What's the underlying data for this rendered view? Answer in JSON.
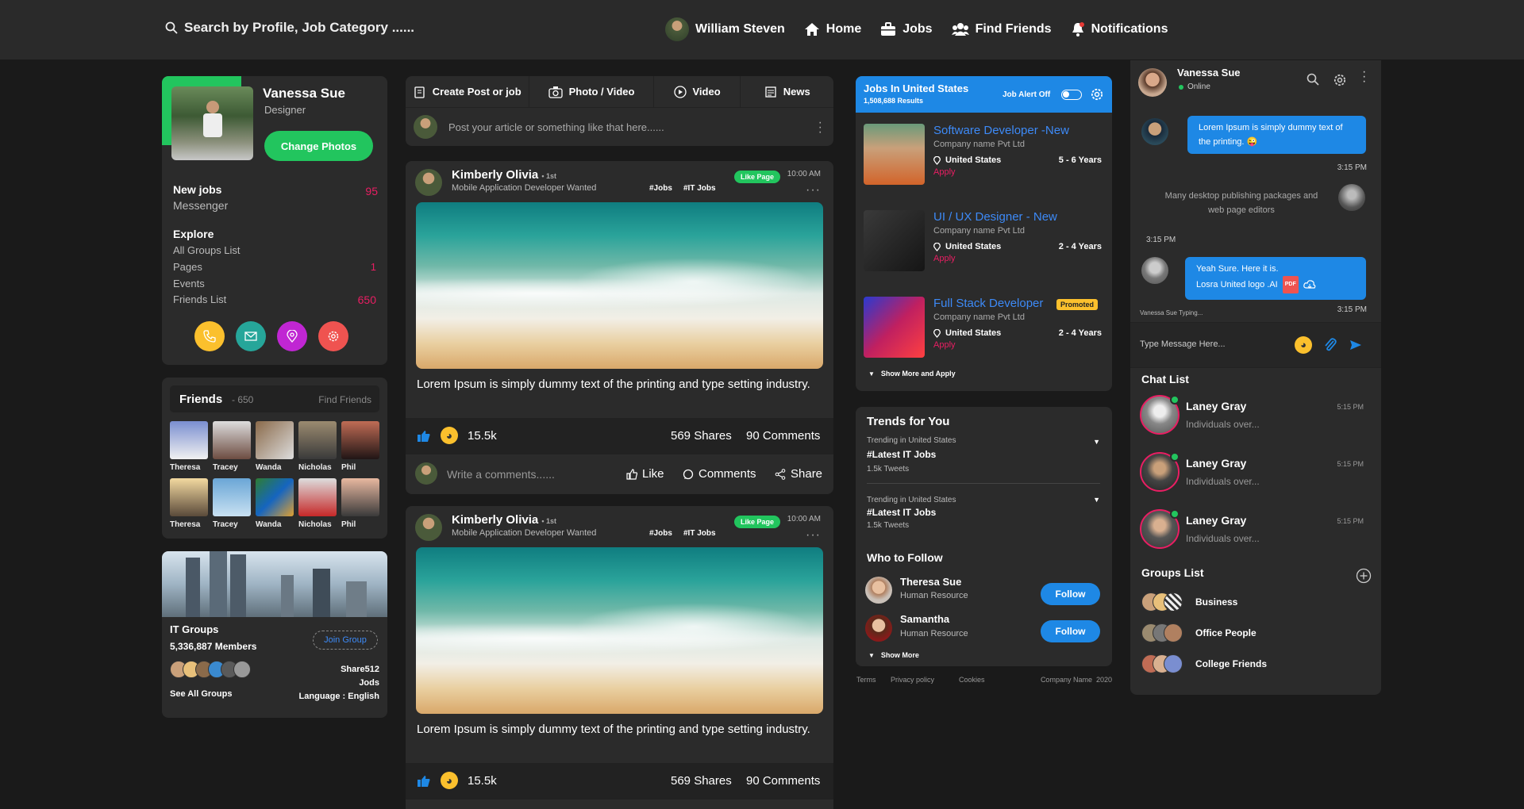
{
  "topbar": {
    "search_placeholder": "Search by Profile, Job Category ......",
    "user_name": "William Steven",
    "nav": [
      "Home",
      "Jobs",
      "Find Friends",
      "Notifications"
    ]
  },
  "profile": {
    "name": "Vanessa Sue",
    "role": "Designer",
    "change_photos": "Change Photos",
    "new_jobs_label": "New jobs",
    "new_jobs_count": "95",
    "messenger": "Messenger",
    "explore": "Explore",
    "links": [
      {
        "label": "All Groups List",
        "count": ""
      },
      {
        "label": "Pages",
        "count": "1"
      },
      {
        "label": "Events",
        "count": ""
      },
      {
        "label": "Friends List",
        "count": "650"
      }
    ]
  },
  "friends": {
    "title": "Friends",
    "count": "- 650",
    "find": "Find Friends",
    "row1": [
      "Theresa",
      "Tracey",
      "Wanda",
      "Nicholas",
      "Phil"
    ],
    "row2": [
      "Theresa",
      "Tracey",
      "Wanda",
      "Nicholas",
      "Phil"
    ]
  },
  "groups_card": {
    "title": "IT Groups",
    "members": "5,336,887 Members",
    "join": "Join Group",
    "share": "Share512",
    "jods": "Jods",
    "language": "Language : English",
    "see_all": "See All Groups"
  },
  "composer": {
    "tabs": [
      "Create Post or job",
      "Photo / Video",
      "Video",
      "News"
    ],
    "placeholder": "Post your article or something like that here......"
  },
  "posts": [
    {
      "author": "Kimberly Olivia",
      "degree": "• 1st",
      "subtitle": "Mobile Application Developer Wanted",
      "tags": [
        "#Jobs",
        "#IT Jobs"
      ],
      "badge": "Like Page",
      "time": "10:00 AM",
      "text": "Lorem Ipsum is simply dummy text of the printing and type setting industry.",
      "likes": "15.5k",
      "shares": "569 Shares",
      "comments": "90 Comments",
      "comment_placeholder": "Write a comments......",
      "actions": [
        "Like",
        "Comments",
        "Share"
      ]
    },
    {
      "author": "Kimberly Olivia",
      "degree": "• 1st",
      "subtitle": "Mobile Application Developer Wanted",
      "tags": [
        "#Jobs",
        "#IT Jobs"
      ],
      "badge": "Like Page",
      "time": "10:00 AM",
      "text": "Lorem Ipsum is simply dummy text of the printing and type setting industry.",
      "likes": "15.5k",
      "shares": "569 Shares",
      "comments": "90 Comments"
    }
  ],
  "jobs": {
    "title": "Jobs In United States",
    "results": "1,508,688 Results",
    "alert": "Job Alert Off",
    "items": [
      {
        "title": "Software Developer -New",
        "company": "Company name Pvt Ltd",
        "location": "United States",
        "exp": "5 - 6 Years",
        "apply": "Apply",
        "promoted": ""
      },
      {
        "title": "UI / UX Designer - New",
        "company": "Company name Pvt Ltd",
        "location": "United States",
        "exp": "2 - 4 Years",
        "apply": "Apply",
        "promoted": ""
      },
      {
        "title": "Full Stack Developer",
        "company": "Company name Pvt Ltd",
        "location": "United States",
        "exp": "2 - 4 Years",
        "apply": "Apply",
        "promoted": "Promoted"
      }
    ],
    "more": "Show More and Apply"
  },
  "trends": {
    "title": "Trends for You",
    "items": [
      {
        "label": "Trending in United States",
        "tag": "#Latest IT Jobs",
        "count": "1.5k Tweets"
      },
      {
        "label": "Trending in United States",
        "tag": "#Latest IT Jobs",
        "count": "1.5k Tweets"
      }
    ],
    "follow_title": "Who to Follow",
    "follow": [
      {
        "name": "Theresa Sue",
        "role": "Human Resource",
        "btn": "Follow"
      },
      {
        "name": "Samantha",
        "role": "Human Resource",
        "btn": "Follow"
      }
    ],
    "show_more": "Show More"
  },
  "footer": {
    "links": [
      "Terms",
      "Privacy policy",
      "Cookies"
    ],
    "company": "Company Name  2020"
  },
  "chat": {
    "name": "Vanessa Sue",
    "status": "Online",
    "messages": [
      {
        "text": "Lorem Ipsum is simply dummy text of the printing. 😜",
        "time": "3:15 PM"
      },
      {
        "text": "Many desktop publishing packages and web page editors",
        "time": "3:15 PM"
      },
      {
        "text1": "Yeah Sure. Here it is.",
        "text2": "Losra United logo .AI",
        "pdf": "PDF",
        "time": "3:15 PM"
      }
    ],
    "typing": "Vanessa Sue Typing...",
    "input_placeholder": "Type Message Here...",
    "list_title": "Chat List",
    "list": [
      {
        "name": "Laney Gray",
        "msg": "Individuals over...",
        "time": "5:15 PM"
      },
      {
        "name": "Laney Gray",
        "msg": "Individuals over...",
        "time": "5:15 PM"
      },
      {
        "name": "Laney Gray",
        "msg": "Individuals over...",
        "time": "5:15 PM"
      }
    ],
    "groups_title": "Groups List",
    "groups": [
      "Business",
      "Office People",
      "College Friends"
    ]
  },
  "colors": {
    "accent": "#1e88e5",
    "green": "#22c55e",
    "pink": "#e91e63",
    "bg": "#1a1a1a",
    "card": "#2b2b2b"
  }
}
